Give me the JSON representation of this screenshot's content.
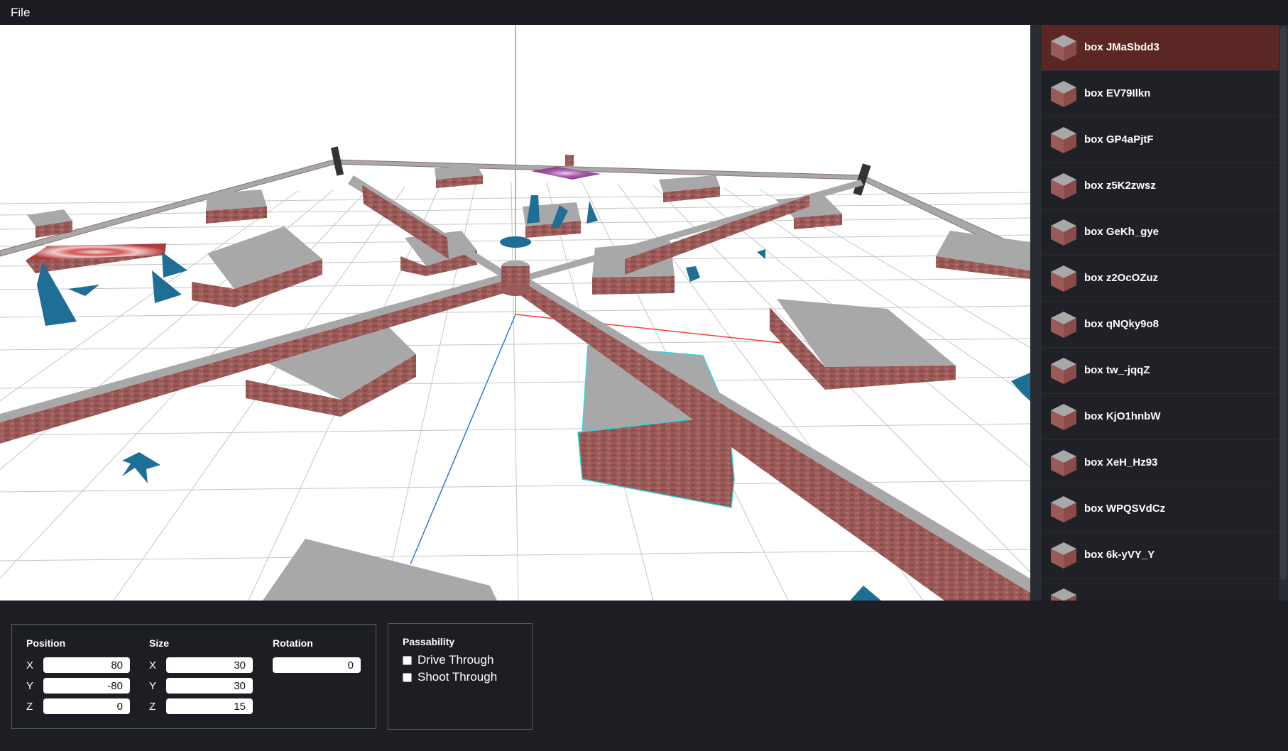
{
  "menu": {
    "file_label": "File"
  },
  "outline": {
    "items": [
      {
        "label": "box JMaSbdd3",
        "selected": true
      },
      {
        "label": "box EV79Ilkn",
        "selected": false
      },
      {
        "label": "box GP4aPjtF",
        "selected": false
      },
      {
        "label": "box z5K2zwsz",
        "selected": false
      },
      {
        "label": "box GeKh_gye",
        "selected": false
      },
      {
        "label": "box z2OcOZuz",
        "selected": false
      },
      {
        "label": "box qNQky9o8",
        "selected": false
      },
      {
        "label": "box tw_-jqqZ",
        "selected": false
      },
      {
        "label": "box KjO1hnbW",
        "selected": false
      },
      {
        "label": "box XeH_Hz93",
        "selected": false
      },
      {
        "label": "box WPQSVdCz",
        "selected": false
      },
      {
        "label": "box 6k-yVY_Y",
        "selected": false
      },
      {
        "label": "",
        "selected": false
      }
    ]
  },
  "properties": {
    "position": {
      "title": "Position",
      "x_label": "X",
      "y_label": "Y",
      "z_label": "Z",
      "x": "80",
      "y": "-80",
      "z": "0"
    },
    "size": {
      "title": "Size",
      "x_label": "X",
      "y_label": "Y",
      "z_label": "Z",
      "x": "30",
      "y": "30",
      "z": "15"
    },
    "rotation": {
      "title": "Rotation",
      "value": "0"
    }
  },
  "passability": {
    "title": "Passability",
    "drive_through": {
      "label": "Drive Through",
      "checked": false
    },
    "shoot_through": {
      "label": "Shoot Through",
      "checked": false
    }
  },
  "colors": {
    "selected_item": "#5b2724",
    "brick": "#9a5a58",
    "top_face": "#a8a8a8",
    "marker": "#1e6e96",
    "axis_x": "#ff3b2f",
    "axis_y": "#46e03a",
    "axis_z": "#2a7bd6",
    "selection_outline": "#2ed7e0"
  }
}
